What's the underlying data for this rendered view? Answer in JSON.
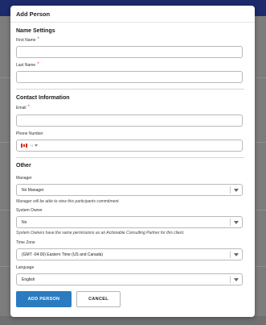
{
  "modal": {
    "title": "Add Person"
  },
  "name_settings": {
    "section_title": "Name Settings",
    "first_name": {
      "label": "First Name",
      "required": "*",
      "value": ""
    },
    "last_name": {
      "label": "Last Name",
      "required": "*",
      "value": ""
    }
  },
  "contact_information": {
    "section_title": "Contact Information",
    "email": {
      "label": "Email",
      "required": "*",
      "value": ""
    },
    "phone": {
      "label": "Phone Number",
      "country_code": "+1",
      "value": ""
    }
  },
  "other": {
    "section_title": "Other",
    "manager": {
      "label": "Manager",
      "value": "No Manager",
      "help": "Manager will be able to view this participants commitment."
    },
    "system_owner": {
      "label": "System Owner",
      "value": "No",
      "help": "System Owners have the same permissions as an Actionable Consulting Partner for this client."
    },
    "time_zone": {
      "label": "Time Zone",
      "value": "(GMT -04:00) Eastern Time (US and Canada)"
    },
    "language": {
      "label": "Language",
      "value": "English"
    }
  },
  "buttons": {
    "add_person": "ADD PERSON",
    "cancel": "CANCEL"
  },
  "colors": {
    "primary": "#2a7bc0",
    "required": "#d9342b",
    "header_bar": "#1d2a6b",
    "overlay": "#7c7c7c"
  },
  "icons": {
    "phone_flag": "canada-flag-icon",
    "select_caret": "chevron-down-icon"
  }
}
